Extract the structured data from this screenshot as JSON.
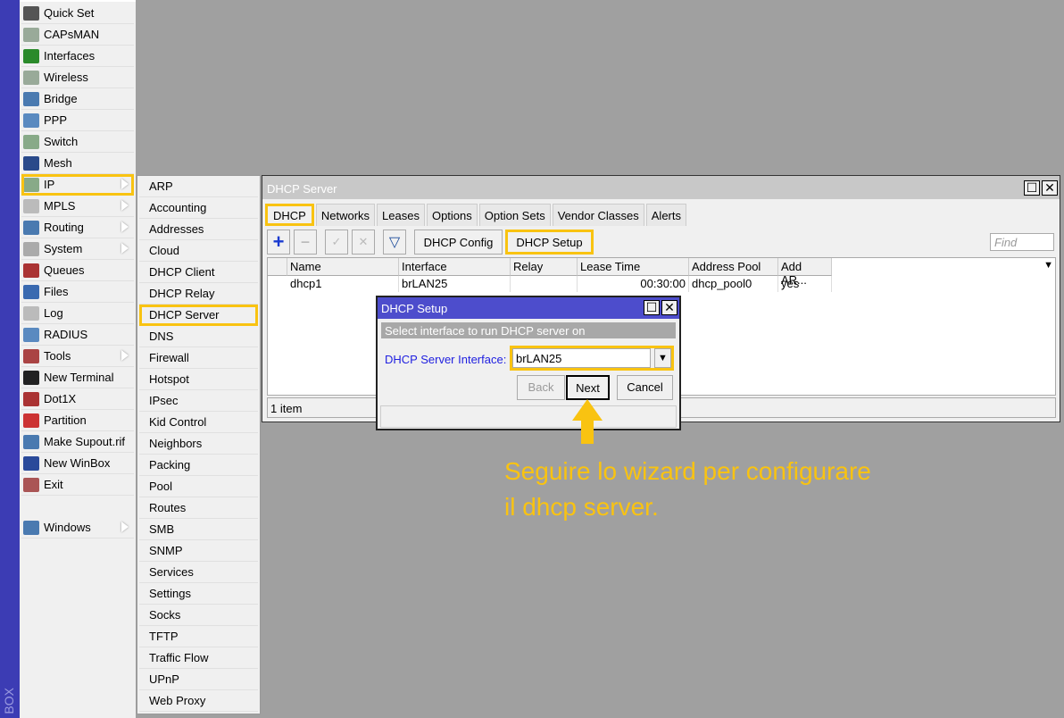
{
  "app": {
    "brand": "BOX"
  },
  "menu": [
    {
      "label": "Quick Set",
      "icon": "quick-set-icon",
      "color": "#555"
    },
    {
      "label": "CAPsMAN",
      "icon": "capsman-icon",
      "color": "#9a9"
    },
    {
      "label": "Interfaces",
      "icon": "interfaces-icon",
      "color": "#2a8a2a"
    },
    {
      "label": "Wireless",
      "icon": "wireless-icon",
      "color": "#9a9"
    },
    {
      "label": "Bridge",
      "icon": "bridge-icon",
      "color": "#4a7ab0"
    },
    {
      "label": "PPP",
      "icon": "ppp-icon",
      "color": "#5a8ac0"
    },
    {
      "label": "Switch",
      "icon": "switch-icon",
      "color": "#8a8"
    },
    {
      "label": "Mesh",
      "icon": "mesh-icon",
      "color": "#2a4a8a"
    },
    {
      "label": "IP",
      "icon": "ip-icon",
      "color": "#8a8",
      "arrow": true,
      "active": true
    },
    {
      "label": "MPLS",
      "icon": "mpls-icon",
      "color": "#bbb",
      "arrow": true
    },
    {
      "label": "Routing",
      "icon": "routing-icon",
      "color": "#4a7ab0",
      "arrow": true
    },
    {
      "label": "System",
      "icon": "system-icon",
      "color": "#aaa",
      "arrow": true
    },
    {
      "label": "Queues",
      "icon": "queues-icon",
      "color": "#a33"
    },
    {
      "label": "Files",
      "icon": "files-icon",
      "color": "#3a6ab0"
    },
    {
      "label": "Log",
      "icon": "log-icon",
      "color": "#bbb"
    },
    {
      "label": "RADIUS",
      "icon": "radius-icon",
      "color": "#5a8ac0"
    },
    {
      "label": "Tools",
      "icon": "tools-icon",
      "color": "#a44",
      "arrow": true
    },
    {
      "label": "New Terminal",
      "icon": "terminal-icon",
      "color": "#222"
    },
    {
      "label": "Dot1X",
      "icon": "dot1x-icon",
      "color": "#a33"
    },
    {
      "label": "Partition",
      "icon": "partition-icon",
      "color": "#c33"
    },
    {
      "label": "Make Supout.rif",
      "icon": "supout-icon",
      "color": "#4a7ab0"
    },
    {
      "label": "New WinBox",
      "icon": "winbox-icon",
      "color": "#2a4a9a"
    },
    {
      "label": "Exit",
      "icon": "exit-icon",
      "color": "#a55"
    },
    null,
    {
      "label": "Windows",
      "icon": "windows-icon",
      "color": "#4a7ab0",
      "arrow": true
    }
  ],
  "submenu": [
    "ARP",
    "Accounting",
    "Addresses",
    "Cloud",
    "DHCP Client",
    "DHCP Relay",
    "DHCP Server",
    "DNS",
    "Firewall",
    "Hotspot",
    "IPsec",
    "Kid Control",
    "Neighbors",
    "Packing",
    "Pool",
    "Routes",
    "SMB",
    "SNMP",
    "Services",
    "Settings",
    "Socks",
    "TFTP",
    "Traffic Flow",
    "UPnP",
    "Web Proxy"
  ],
  "submenu_active": "DHCP Server",
  "window": {
    "title": "DHCP Server",
    "tabs": [
      "DHCP",
      "Networks",
      "Leases",
      "Options",
      "Option Sets",
      "Vendor Classes",
      "Alerts"
    ],
    "active_tab": "DHCP",
    "toolbar": {
      "config": "DHCP Config",
      "setup": "DHCP Setup",
      "find_placeholder": "Find"
    },
    "columns": [
      "Name",
      "Interface",
      "Relay",
      "Lease Time",
      "Address Pool",
      "Add AR..."
    ],
    "rows": [
      [
        "dhcp1",
        "brLAN25",
        "",
        "00:30:00",
        "dhcp_pool0",
        "yes"
      ]
    ],
    "status": "1 item"
  },
  "dialog": {
    "title": "DHCP Setup",
    "heading": "Select interface to run DHCP server on",
    "field_label": "DHCP Server Interface:",
    "field_value": "brLAN25",
    "back": "Back",
    "next": "Next",
    "cancel": "Cancel"
  },
  "annotation": {
    "line1": "Seguire lo wizard per configurare",
    "line2": "il dhcp server.",
    "color": "#f9c311"
  }
}
